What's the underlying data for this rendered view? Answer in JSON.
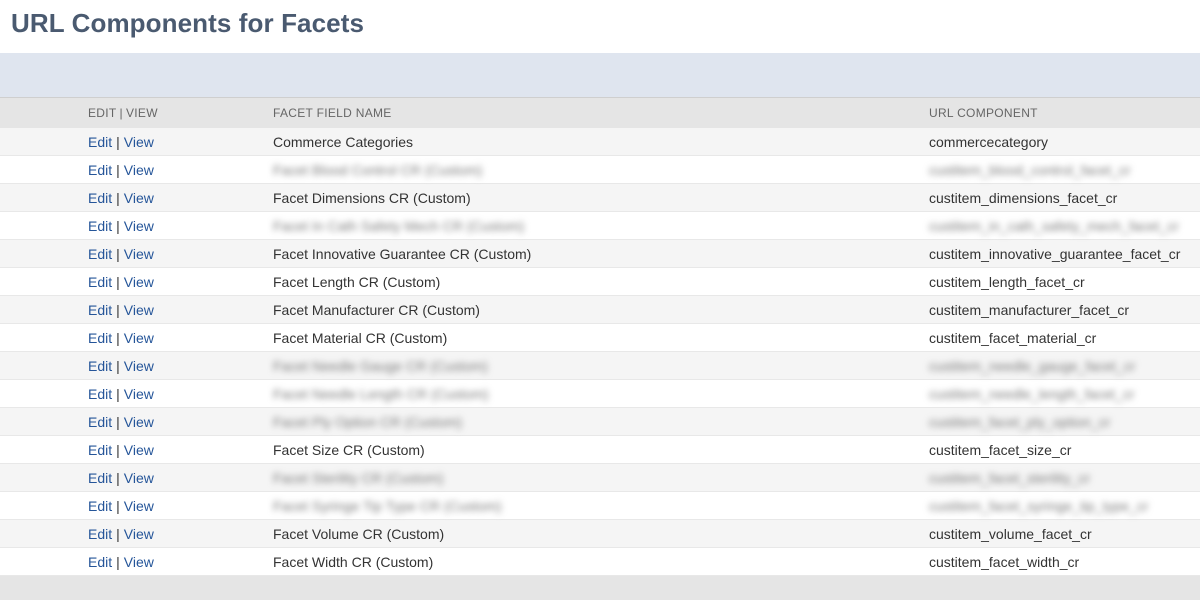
{
  "page": {
    "title": "URL Components for Facets"
  },
  "table": {
    "headers": {
      "edit_label": "EDIT",
      "separator": "|",
      "view_label": "VIEW",
      "facet_field_name": "FACET FIELD NAME",
      "url_component": "URL COMPONENT"
    },
    "action_labels": {
      "edit": "Edit",
      "separator": "|",
      "view": "View"
    },
    "rows": [
      {
        "name": "Commerce Categories",
        "url": "commercecategory",
        "redacted": false
      },
      {
        "name": "Facet Blood Control CR (Custom)",
        "url": "custitem_blood_control_facet_cr",
        "redacted": true
      },
      {
        "name": "Facet Dimensions CR (Custom)",
        "url": "custitem_dimensions_facet_cr",
        "redacted": false
      },
      {
        "name": "Facet In Cath Safety Mech CR (Custom)",
        "url": "custitem_in_cath_safety_mech_facet_cr",
        "redacted": true
      },
      {
        "name": "Facet Innovative Guarantee CR (Custom)",
        "url": "custitem_innovative_guarantee_facet_cr",
        "redacted": false
      },
      {
        "name": "Facet Length CR (Custom)",
        "url": "custitem_length_facet_cr",
        "redacted": false
      },
      {
        "name": "Facet Manufacturer CR (Custom)",
        "url": "custitem_manufacturer_facet_cr",
        "redacted": false
      },
      {
        "name": "Facet Material CR (Custom)",
        "url": "custitem_facet_material_cr",
        "redacted": false
      },
      {
        "name": "Facet Needle Gauge CR (Custom)",
        "url": "custitem_needle_gauge_facet_cr",
        "redacted": true
      },
      {
        "name": "Facet Needle Length CR (Custom)",
        "url": "custitem_needle_length_facet_cr",
        "redacted": true
      },
      {
        "name": "Facet Ply Option CR (Custom)",
        "url": "custitem_facet_ply_option_cr",
        "redacted": true
      },
      {
        "name": "Facet Size CR (Custom)",
        "url": "custitem_facet_size_cr",
        "redacted": false
      },
      {
        "name": "Facet Sterility CR (Custom)",
        "url": "custitem_facet_sterility_cr",
        "redacted": true
      },
      {
        "name": "Facet Syringe Tip Type CR (Custom)",
        "url": "custitem_facet_syringe_tip_type_cr",
        "redacted": true
      },
      {
        "name": "Facet Volume CR (Custom)",
        "url": "custitem_volume_facet_cr",
        "redacted": false
      },
      {
        "name": "Facet Width CR (Custom)",
        "url": "custitem_facet_width_cr",
        "redacted": false
      }
    ]
  },
  "colors": {
    "title": "#4a5a70",
    "toolbar_band": "#dfe5ef",
    "header_bg": "#e5e5e5",
    "row_alt_bg": "#f5f5f5",
    "link": "#255599"
  }
}
